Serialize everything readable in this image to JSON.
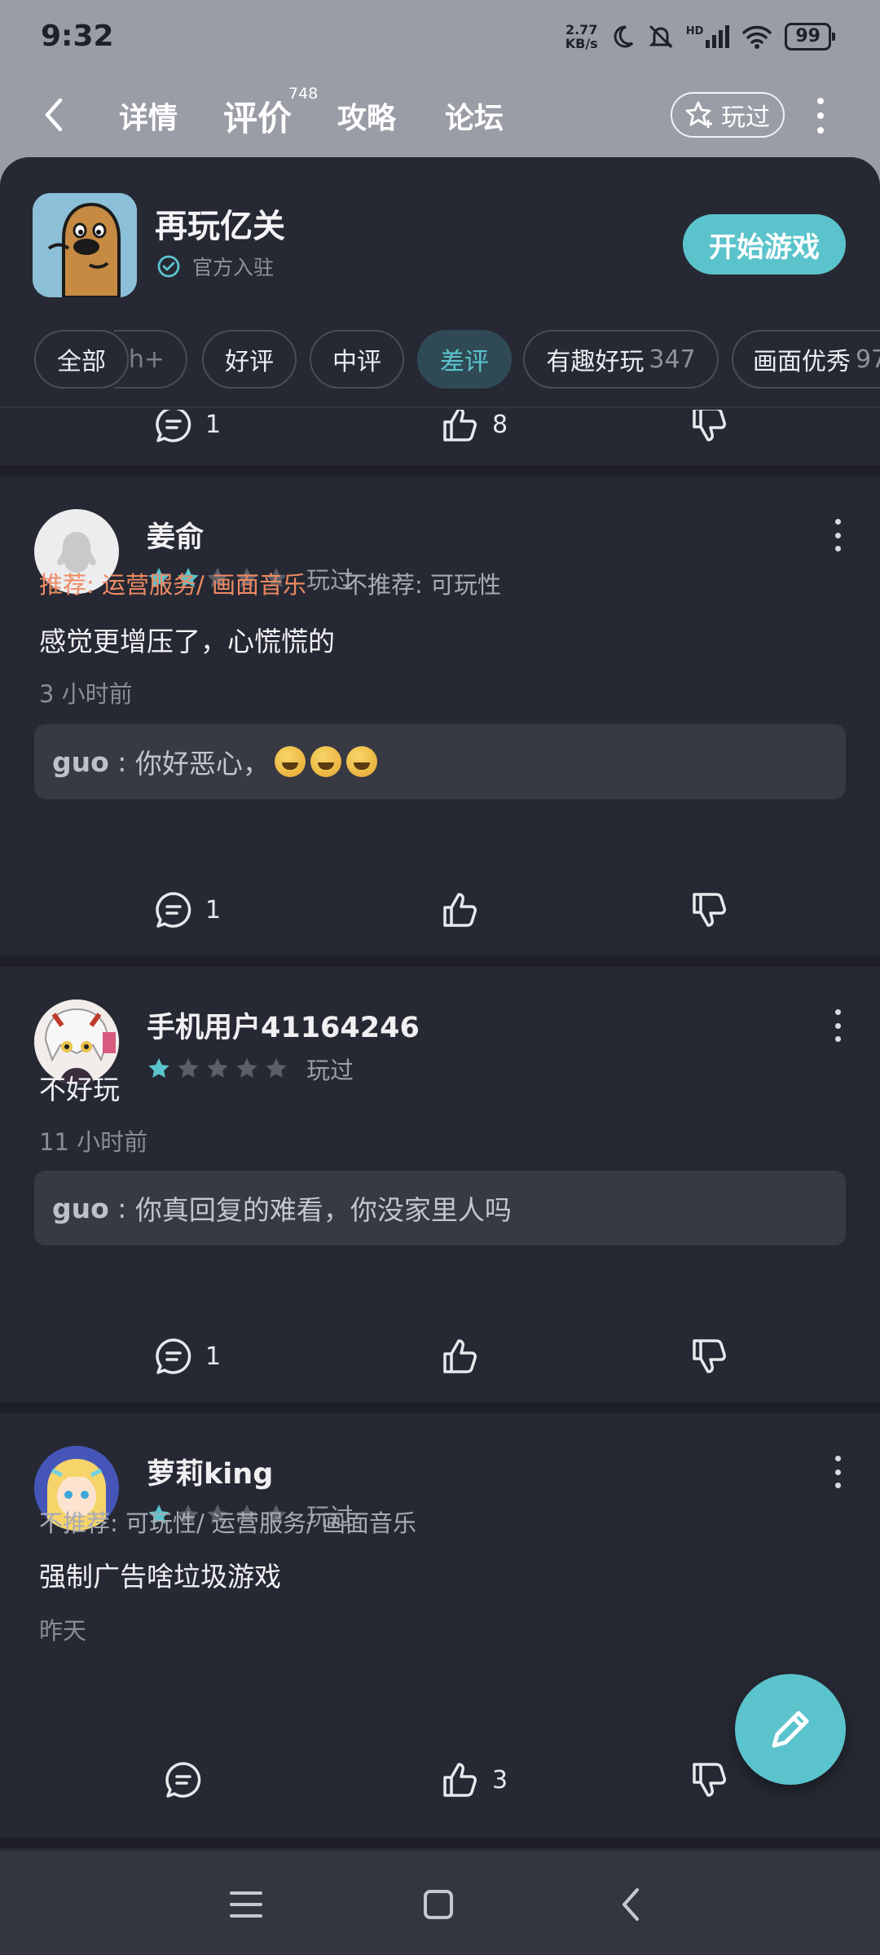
{
  "status": {
    "time": "9:32",
    "net_speed_value": "2.77",
    "net_speed_unit": "KB/s",
    "signal_label": "HD",
    "battery": "99"
  },
  "nav": {
    "tabs": [
      {
        "label": "详情"
      },
      {
        "label": "评价",
        "badge": "748"
      },
      {
        "label": "攻略"
      },
      {
        "label": "论坛"
      }
    ],
    "played_button": "玩过"
  },
  "game": {
    "name": "再玩亿关",
    "official_label": "官方入驻",
    "start_button": "开始游戏"
  },
  "filters": [
    {
      "label": "全部"
    },
    {
      "label": "h+"
    },
    {
      "label": "好评"
    },
    {
      "label": "中评"
    },
    {
      "label": "差评"
    },
    {
      "label": "有趣好玩",
      "count": "347"
    },
    {
      "label": "画面优秀",
      "count": "97"
    }
  ],
  "prev_review_actions": {
    "comments": "1",
    "likes": "8"
  },
  "reviews": [
    {
      "user": "姜俞",
      "stars": 2,
      "played": "玩过",
      "recommend": "推荐: 运营服务/ 画面音乐",
      "not_recommend": "不推荐: 可玩性",
      "content": "感觉更增压了，心慌慌的",
      "time": "3 小时前",
      "reply_author": "guo",
      "reply_separator": " : ",
      "reply_text": "你好恶心，",
      "comments": "1"
    },
    {
      "user": "手机用户41164246",
      "stars": 1,
      "played": "玩过",
      "content": "不好玩",
      "time": "11 小时前",
      "reply_author": "guo",
      "reply_separator": " : ",
      "reply_text": "你真回复的难看，你没家里人吗",
      "comments": "1"
    },
    {
      "user": "萝莉king",
      "stars": 1,
      "played": "玩过",
      "not_recommend": "不推荐: 可玩性/ 运营服务/ 画面音乐",
      "content": "强制广告啥垃圾游戏",
      "time": "昨天",
      "likes": "3"
    }
  ],
  "colors": {
    "accent": "#5BC3CB",
    "background": "#262833",
    "recommend": "#EE8A63",
    "star_filled": "#5BC3CB",
    "star_empty": "#5C5F6A"
  },
  "icons": [
    "back-icon",
    "star-plus-icon",
    "more-icon",
    "check-circle-icon",
    "comment-icon",
    "thumbs-up-icon",
    "thumbs-down-icon",
    "edit-icon",
    "menu-icon",
    "home-icon",
    "nav-back-icon"
  ]
}
